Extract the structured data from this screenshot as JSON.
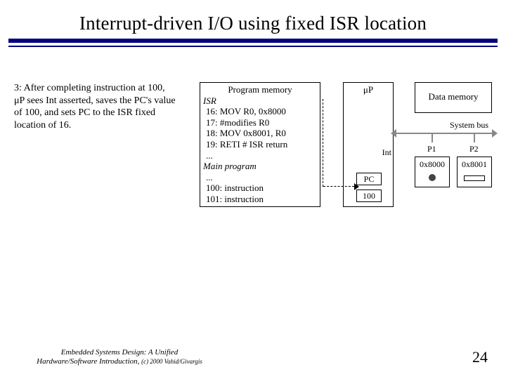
{
  "title": "Interrupt-driven I/O using fixed ISR location",
  "explain": "3: After completing instruction at 100, μP sees Int asserted, saves the PC's value of 100, and sets PC to the ISR fixed location of 16.",
  "progmem": {
    "header": "Program memory",
    "isr_label": "ISR",
    "line16": "16:  MOV R0, 0x8000",
    "line17": "17:  #modifies R0",
    "line18": "18:  MOV 0x8001, R0",
    "line19": "19:  RETI  # ISR return",
    "dots1": "...",
    "main_label": "Main program",
    "dots2": "...",
    "line100": "100: instruction",
    "line101": "101: instruction"
  },
  "cpu": {
    "label": "μP",
    "int": "Int",
    "pc_label": "PC",
    "pc_value": "100"
  },
  "datamem": {
    "label": "Data memory"
  },
  "bus": {
    "label": "System bus",
    "p1_label": "P1",
    "p2_label": "P2",
    "p1_addr": "0x8000",
    "p2_addr": "0x8001"
  },
  "footer": {
    "line1": "Embedded Systems Design: A Unified",
    "line2": "Hardware/Software Introduction, ",
    "copyright": "(c) 2000 Vahid/Givargis"
  },
  "page": "24"
}
